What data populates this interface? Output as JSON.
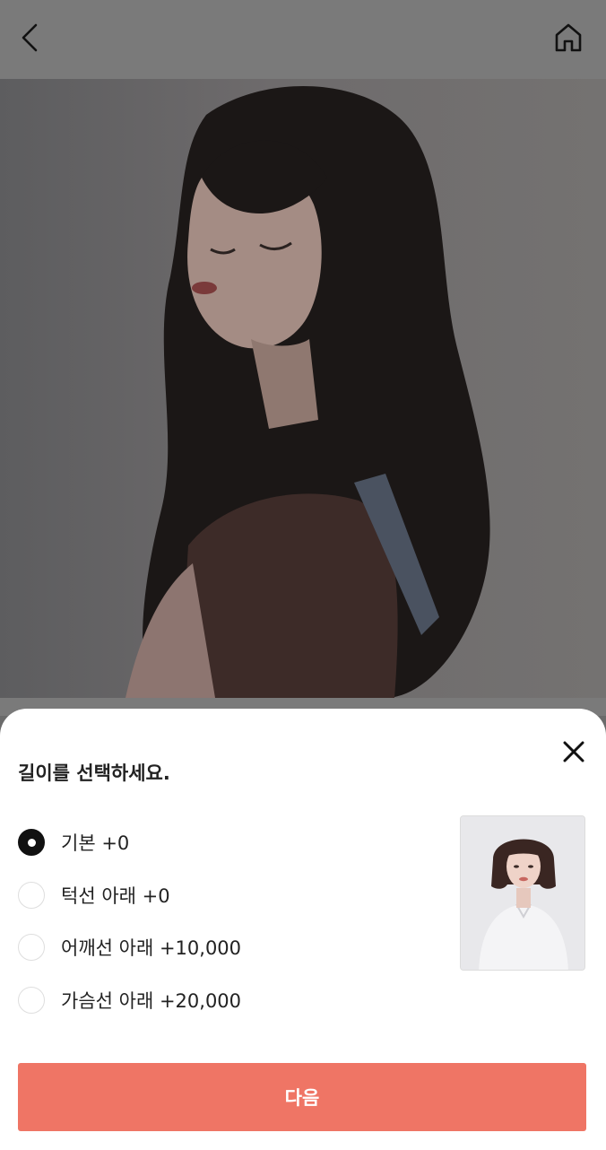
{
  "header": {
    "back_icon": "chevron-left-icon",
    "home_icon": "home-icon"
  },
  "sheet": {
    "title": "길이를 선택하세요.",
    "close_icon": "close-icon",
    "options": [
      {
        "label": "기본 +0",
        "selected": true
      },
      {
        "label": "턱선 아래 +0",
        "selected": false
      },
      {
        "label": "어깨선 아래 +10,000",
        "selected": false
      },
      {
        "label": "가슴선 아래 +20,000",
        "selected": false
      }
    ],
    "next_label": "다음"
  },
  "colors": {
    "accent": "#ef7565",
    "overlay": "#6b6b6b"
  }
}
